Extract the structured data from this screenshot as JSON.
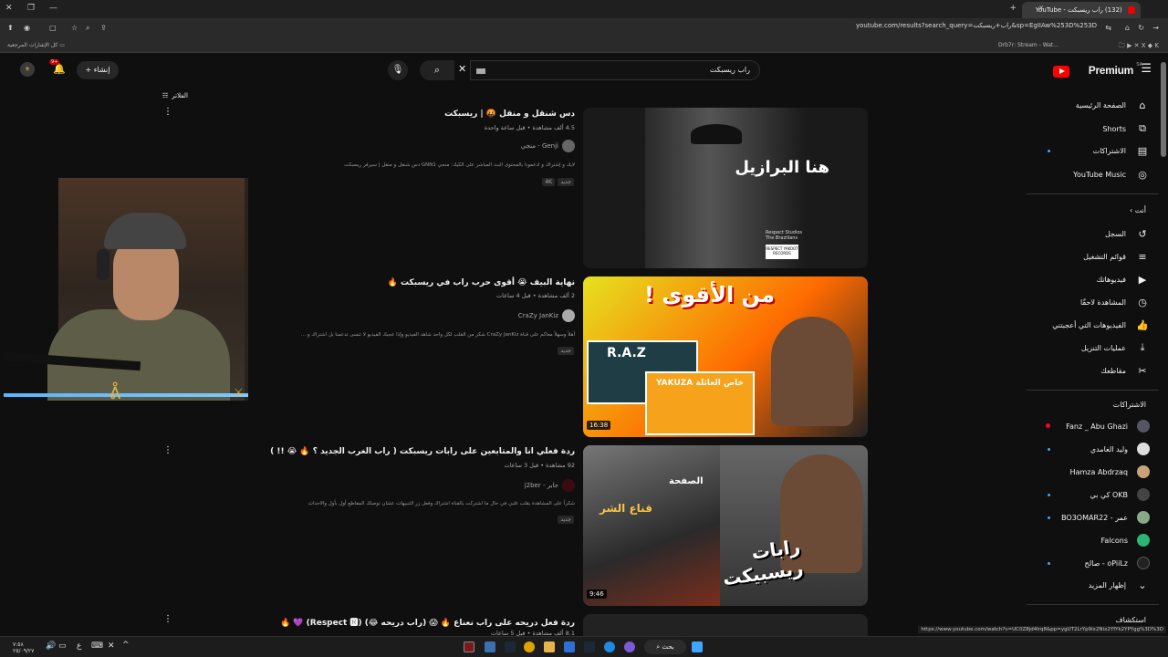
{
  "browser": {
    "tab_title": "(132) راب ريسبكت - YouTube",
    "url": "youtube.com/results?search_query=راب+ريسبكت&sp=EgIIAw%253D%253D",
    "bookmarks_folder": "كل الإشارات المرجعية",
    "bookmark_1": "Drb7r: Stream - Wat..."
  },
  "header": {
    "logo": "Premium",
    "logo_country": "SA",
    "search_value": "راب ريسبكت",
    "create_label": "إنشاء",
    "notif_count": "9+"
  },
  "sidebar": {
    "main": [
      {
        "label": "الصفحة الرئيسية",
        "icon": "home-icon"
      },
      {
        "label": "Shorts",
        "icon": "shorts-icon"
      },
      {
        "label": "الاشتراكات",
        "icon": "subscriptions-icon"
      },
      {
        "label": "YouTube Music",
        "icon": "music-icon"
      }
    ],
    "you_header": "أنت",
    "you": [
      {
        "label": "السجل",
        "icon": "history-icon"
      },
      {
        "label": "قوائم التشغيل",
        "icon": "playlists-icon"
      },
      {
        "label": "فيديوهاتك",
        "icon": "your-videos-icon"
      },
      {
        "label": "المشاهدة لاحقًا",
        "icon": "watch-later-icon"
      },
      {
        "label": "الفيديوهات التي أعجبتني",
        "icon": "liked-icon"
      },
      {
        "label": "عمليات التنزيل",
        "icon": "download-icon"
      },
      {
        "label": "مقاطعك",
        "icon": "clips-icon"
      }
    ],
    "subs_header": "الاشتراكات",
    "subs": [
      {
        "label": "Fanz _ Abu Ghazi",
        "live": true
      },
      {
        "label": "وليد الغامدي",
        "live": false
      },
      {
        "label": "Hamza Abdrzaq",
        "live": false
      },
      {
        "label": "كي بي OKB",
        "live": false
      },
      {
        "label": "BO3OMAR22 - عمر",
        "live": false
      },
      {
        "label": "Falcons",
        "live": false
      },
      {
        "label": "صالح - oPiiLz",
        "live": false
      },
      {
        "label": "إظهار المزيد",
        "live": false
      }
    ],
    "explore_header": "استكشاف"
  },
  "filters_label": "الفلاتر",
  "results": [
    {
      "title": "دس شنقل و منقل 🤬 | ريسبكت",
      "meta": "4.5 ألف مشاهدة • قبل ساعة واحدة",
      "channel": "Genji - منجي",
      "desc": "لايك و إشتراك و ادعمونا بالمحتوى البث المباشر على الكيك: منجي GNN1 دس شنقل و منقل | سيرفر ريسبكت",
      "badges": [
        "4K",
        "جديد"
      ],
      "thumb_text": "هنا البرازيل",
      "thumb_sub": "Respect Studios The Brazilians",
      "thumb_badge": "RESPECT YAKOOT RECORDS",
      "duration": ""
    },
    {
      "title": "نهاية البيف 😭 أقوى حرب راب في ريسبكت 🔥",
      "meta": "2 ألف مشاهدة • قبل 4 ساعات",
      "channel": "CraZy JanKiz",
      "desc": "أهلاً وسهلاً معاكم على قناة CraZy JanKiz شكر من القلب لكل واحد شاهد الفيديو وإذا عجبك الفيديو لا تنسى تدعمنا بل اشتراك و ...",
      "badges": [
        "جديد"
      ],
      "thumb_text": "من الأقوى !",
      "thumb_sub": "R.A.Z",
      "thumb_badge": "YAKUZA خاص العائلة",
      "duration": "16:38"
    },
    {
      "title": "ردة فعلي انا والمتابعين على رابات ريسبكت ( راب الغرب الجديد ؟ 🔥 😭 !! )",
      "meta": "92 مشاهدة • قبل 3 ساعات",
      "channel": "جابر - j2ber",
      "desc": "شكراً على المشاهدة يقلب غلبي في حال ما اشتركت بالقناة اشتراك وفعل زر التنبيهات عشان توصلك المقاطع أول بأول والاحداث",
      "badges": [
        "جديد"
      ],
      "thumb_text": "رابات ريسبيكت",
      "thumb_sub": "الصفحة",
      "thumb_badge": "قناع الشر",
      "duration": "9:46"
    },
    {
      "title": "ردة فعل دريحه على راب نعناع 🔥 😱 (راب دريحه 😂) (Respect 🆁) 💜 🔥",
      "meta": "8.1 ألف مشاهدة • قبل 5 ساعات",
      "channel": "",
      "desc": "",
      "badges": [],
      "duration": ""
    }
  ],
  "status_url": "https://www.youtube.com/watch?v=UC0Z8jd4lrq8&pp=ygUT2LrYp9ix2Nix2YfYk2YPYgg%3D%3D",
  "taskbar": {
    "search": "بحث",
    "time": "٧:٥٨",
    "date": "٢٥/٠٩/٢٧",
    "lang": "ع"
  },
  "colors": {
    "accent": "#ff0000",
    "link": "#3ea6ff",
    "bg": "#0f0f0f"
  }
}
